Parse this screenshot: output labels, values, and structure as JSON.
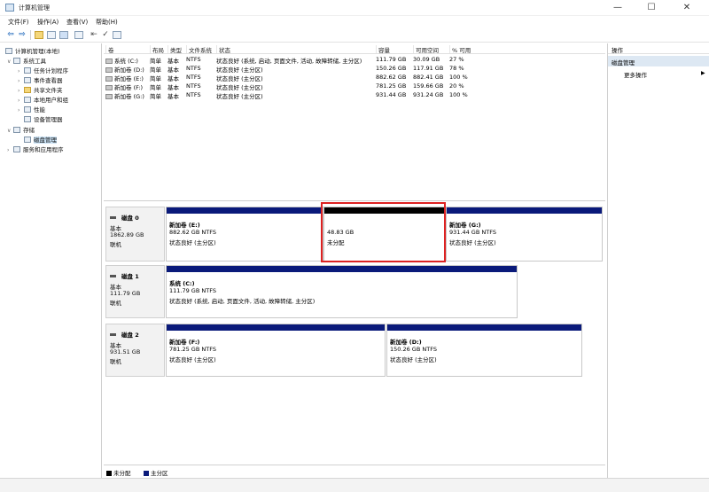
{
  "window": {
    "title": "计算机管理",
    "minimize": "—",
    "maximize": "☐",
    "close": "✕"
  },
  "menu": [
    "文件(F)",
    "操作(A)",
    "查看(V)",
    "帮助(H)"
  ],
  "toolbar": {
    "icons": [
      "back-icon",
      "forward-icon",
      "folder-icon",
      "properties-icon",
      "help-icon",
      "details-icon",
      "help-book-icon",
      "check-icon",
      "view-icon"
    ]
  },
  "tree": {
    "root": "计算机管理(本地)",
    "system_tools": "系统工具",
    "task_scheduler": "任务计划程序",
    "event_viewer": "事件查看器",
    "shared_folders": "共享文件夹",
    "local_users": "本地用户和组",
    "performance": "性能",
    "device_manager": "设备管理器",
    "storage": "存储",
    "disk_management": "磁盘管理",
    "services_apps": "服务和应用程序"
  },
  "volume_list": {
    "columns": [
      "卷",
      "布局",
      "类型",
      "文件系统",
      "状态",
      "容量",
      "可用空间",
      "% 可用"
    ],
    "rows": [
      [
        "系统 (C:)",
        "简单",
        "基本",
        "NTFS",
        "状态良好 (系统, 启动, 页面文件, 活动, 故障转储, 主分区)",
        "111.79 GB",
        "30.09 GB",
        "27 %"
      ],
      [
        "新加卷 (D:)",
        "简单",
        "基本",
        "NTFS",
        "状态良好 (主分区)",
        "150.26 GB",
        "117.91 GB",
        "78 %"
      ],
      [
        "新加卷 (E:)",
        "简单",
        "基本",
        "NTFS",
        "状态良好 (主分区)",
        "882.62 GB",
        "882.41 GB",
        "100 %"
      ],
      [
        "新加卷 (F:)",
        "简单",
        "基本",
        "NTFS",
        "状态良好 (主分区)",
        "781.25 GB",
        "159.66 GB",
        "20 %"
      ],
      [
        "新加卷 (G:)",
        "简单",
        "基本",
        "NTFS",
        "状态良好 (主分区)",
        "931.44 GB",
        "931.24 GB",
        "100 %"
      ]
    ]
  },
  "disks": [
    {
      "name": "磁盘 0",
      "type": "基本",
      "size": "1862.89 GB",
      "status": "联机",
      "partitions": [
        {
          "kind": "primary",
          "name": "新加卷 (E:)",
          "size": "882.62 GB NTFS",
          "status": "状态良好 (主分区)"
        },
        {
          "kind": "unallocated",
          "name": "",
          "size": "48.83 GB",
          "status": "未分配"
        },
        {
          "kind": "primary",
          "name": "新加卷 (G:)",
          "size": "931.44 GB NTFS",
          "status": "状态良好 (主分区)"
        }
      ]
    },
    {
      "name": "磁盘 1",
      "type": "基本",
      "size": "111.79 GB",
      "status": "联机",
      "partitions": [
        {
          "kind": "primary",
          "name": "系统 (C:)",
          "size": "111.79 GB NTFS",
          "status": "状态良好 (系统, 启动, 页面文件, 活动, 故障转储, 主分区)"
        }
      ]
    },
    {
      "name": "磁盘 2",
      "type": "基本",
      "size": "931.51 GB",
      "status": "联机",
      "partitions": [
        {
          "kind": "primary",
          "name": "新加卷 (F:)",
          "size": "781.25 GB NTFS",
          "status": "状态良好 (主分区)"
        },
        {
          "kind": "primary",
          "name": "新加卷 (D:)",
          "size": "150.26 GB NTFS",
          "status": "状态良好 (主分区)"
        }
      ]
    }
  ],
  "legend": {
    "unallocated": "未分配",
    "primary": "主分区"
  },
  "actions": {
    "header": "操作",
    "section": "磁盘管理",
    "more": "更多操作",
    "more_arrow": "▶"
  },
  "colors": {
    "primary_bar": "#0a1a7a",
    "unallocated_bar": "#000000",
    "highlight": "#dd2222",
    "selection": "#cce4f7"
  }
}
